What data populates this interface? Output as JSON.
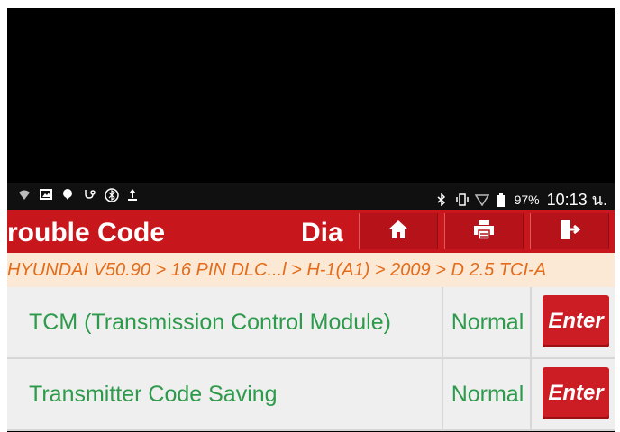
{
  "statusbar": {
    "battery": "97%",
    "time": "10:13 น."
  },
  "titlebar": {
    "title": "rouble Code",
    "title2": "Dia",
    "home_icon": "home-icon",
    "print_icon": "printer-icon",
    "exit_icon": "exit-icon"
  },
  "breadcrumb": {
    "text": "HYUNDAI V50.90 > 16 PIN DLC...l > H-1(A1) > 2009 > D 2.5 TCI-A"
  },
  "rows": [
    {
      "name": "TCM (Transmission Control Module)",
      "status": "Normal",
      "action": "Enter"
    },
    {
      "name": "Transmitter Code Saving",
      "status": "Normal",
      "action": "Enter"
    }
  ],
  "colors": {
    "accent": "#c8161d",
    "green_text": "#2e9a4b",
    "breadcrumb_text": "#e36b1a",
    "breadcrumb_bg": "#fbe9d6"
  }
}
